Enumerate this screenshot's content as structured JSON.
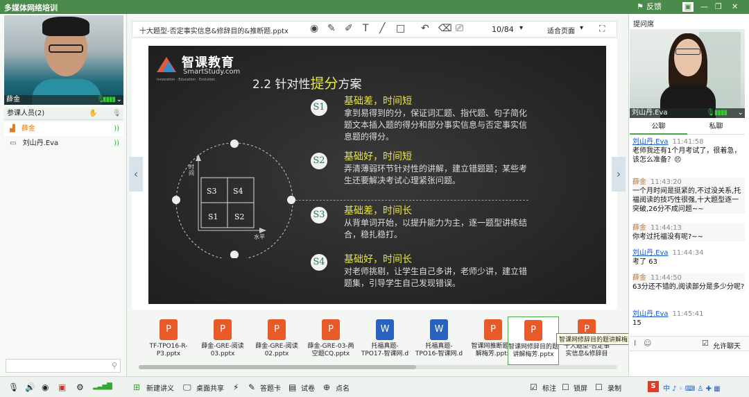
{
  "app": {
    "title": "多媒体网络培训",
    "feedback": "反馈",
    "window_controls": [
      "minimize",
      "restore",
      "close"
    ]
  },
  "left": {
    "video_name": "薛金",
    "participants_title": "参课人员(2)",
    "participants": [
      {
        "name": "薛金",
        "color": "#e07a1a"
      },
      {
        "name": "刘山丹.Eva",
        "color": "#222222"
      }
    ]
  },
  "toolbar": {
    "file_name": "十大题型-否定事实信息&修辞目的&推断题.pptx",
    "page": "10/84",
    "fit": "适合页面"
  },
  "slide": {
    "logo_cn": "智课教育",
    "logo_en": "SmartStudy.com",
    "logo_tag": "Innovation · Education · Evolution",
    "heading_pre": "2.2 针对性",
    "heading_em": "提分",
    "heading_post": "方案",
    "axis_y": "时间",
    "axis_x": "水平",
    "quadrants": [
      "S3",
      "S4",
      "S1",
      "S2"
    ],
    "items": [
      {
        "num": "S1",
        "title": "基础差，时间短",
        "text": "拿到易得到的分，保证词汇题、指代题、句子简化题文本插入题的得分和部分事实信息与否定事实信息题的得分。"
      },
      {
        "num": "S2",
        "title": "基础好，时间短",
        "text": "弄清薄弱环节针对性的讲解，建立错题题；某些考生还要解决考试心理紧张问题。"
      },
      {
        "num": "S3",
        "title": "基础差，时间长",
        "text": "从背单词开始，以提升能力为主，逐一题型讲练结合，稳扎稳打。"
      },
      {
        "num": "S4",
        "title": "基础好，时间长",
        "text": "对老师挑剔，让学生自己多讲，老师少讲，建立错题集，引导学生自己发现错误。"
      }
    ]
  },
  "files": [
    {
      "name": "TF-TPO16-R-P3.pptx",
      "type": "ppt"
    },
    {
      "name": "薛金-GRE-阅读03.pptx",
      "type": "ppt"
    },
    {
      "name": "薛金-GRE-阅读02.pptx",
      "type": "ppt"
    },
    {
      "name": "薛金-GRE-03-两空题CQ.pptx",
      "type": "ppt"
    },
    {
      "name": "托福真题-TPO17-智课网.d",
      "type": "doc"
    },
    {
      "name": "托福真题-TPO16-智课网.d",
      "type": "doc"
    },
    {
      "name": "智课网推断题讲解梅芳.pptx",
      "type": "ppt"
    },
    {
      "name": "智课网修辞目的题讲解梅芳.pptx",
      "type": "ppt"
    },
    {
      "name": "十大题型-否定事实信息&修辞目",
      "type": "ppt"
    }
  ],
  "tooltip": "智课网修辞目的题讲解梅芳.pptx",
  "right": {
    "qa_title": "提问席",
    "video_name": "刘山丹.Eva",
    "tabs": [
      "公聊",
      "私聊"
    ],
    "messages": [
      {
        "name": "刘山丹.Eva",
        "self": false,
        "time": "11:41:58",
        "text": "老师我还有1个月考试了，很着急，该怎么准备？😣"
      },
      {
        "name": "薛金",
        "self": true,
        "time": "11:43:20",
        "text": "一个月时间是挺紧的,不过没关系,托福阅读的技巧性很强,十大题型逐一突破,26分不成问题~~"
      },
      {
        "name": "薛金",
        "self": true,
        "time": "11:44:13",
        "text": "你考过托福没有呢?~~"
      },
      {
        "name": "刘山丹.Eva",
        "self": false,
        "time": "11:44:34",
        "text": "考了 63"
      },
      {
        "name": "薛金",
        "self": true,
        "time": "11:44:50",
        "text": "63分还不错的,阅读部分是多少分呢?"
      },
      {
        "name": "刘山丹.Eva",
        "self": false,
        "time": "11:45:41",
        "text": "15"
      }
    ],
    "allow_chat": "允许聊天"
  },
  "bottom": {
    "new_lecture": "新建讲义",
    "desktop_share": "桌面共享",
    "answer_card": "答题卡",
    "quiz": "试卷",
    "roll_call": "点名",
    "annotate": "标注",
    "lock_screen": "锁屏",
    "record": "录制"
  }
}
